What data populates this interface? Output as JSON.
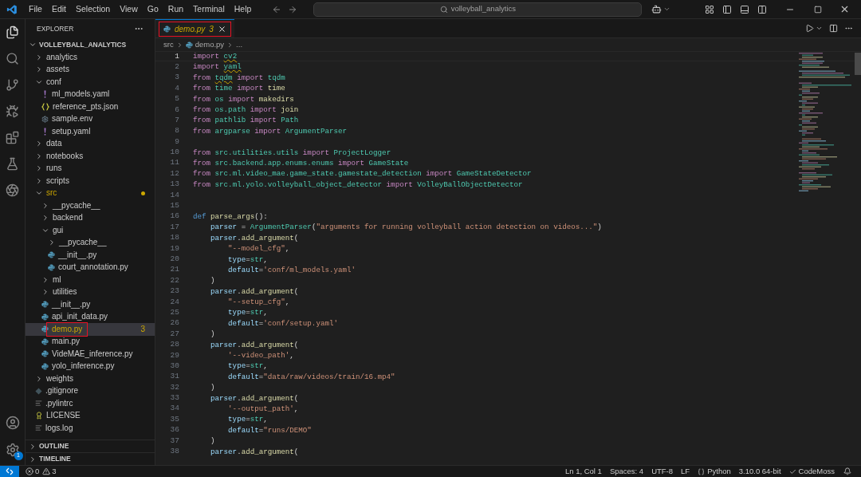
{
  "menu": [
    "File",
    "Edit",
    "Selection",
    "View",
    "Go",
    "Run",
    "Terminal",
    "Help"
  ],
  "command_center": {
    "text": "volleyball_analytics"
  },
  "settings_badge": "1",
  "explorer": {
    "title": "EXPLORER",
    "root": {
      "label": "VOLLEYBALL_ANALYTICS",
      "expanded": true
    },
    "items": [
      {
        "label": "analytics",
        "kind": "folder",
        "expanded": false,
        "selected": false,
        "warning": false,
        "annotated": false
      },
      {
        "label": "assets",
        "kind": "folder",
        "expanded": false,
        "selected": false,
        "warning": false,
        "annotated": false
      },
      {
        "label": "conf",
        "kind": "folder",
        "expanded": true,
        "selected": false,
        "warning": false,
        "annotated": false,
        "children": [
          {
            "label": "ml_models.yaml",
            "kind": "yaml",
            "selected": false,
            "warning": false,
            "annotated": false
          },
          {
            "label": "reference_pts.json",
            "kind": "json",
            "selected": false,
            "warning": false,
            "annotated": false
          },
          {
            "label": "sample.env",
            "kind": "env",
            "selected": false,
            "warning": false,
            "annotated": false
          },
          {
            "label": "setup.yaml",
            "kind": "yaml",
            "selected": false,
            "warning": false,
            "annotated": false
          }
        ]
      },
      {
        "label": "data",
        "kind": "folder",
        "expanded": false,
        "selected": false,
        "warning": false,
        "annotated": false
      },
      {
        "label": "notebooks",
        "kind": "folder",
        "expanded": false,
        "selected": false,
        "warning": false,
        "annotated": false
      },
      {
        "label": "runs",
        "kind": "folder",
        "expanded": false,
        "selected": false,
        "warning": false,
        "annotated": false
      },
      {
        "label": "scripts",
        "kind": "folder",
        "expanded": false,
        "selected": false,
        "warning": false,
        "annotated": false
      },
      {
        "label": "src",
        "kind": "folder",
        "expanded": true,
        "selected": false,
        "warning": true,
        "annotated": false,
        "children": [
          {
            "label": "__pycache__",
            "kind": "folder",
            "expanded": false,
            "selected": false,
            "warning": false,
            "annotated": false
          },
          {
            "label": "backend",
            "kind": "folder",
            "expanded": false,
            "selected": false,
            "warning": false,
            "annotated": false
          },
          {
            "label": "gui",
            "kind": "folder",
            "expanded": true,
            "selected": false,
            "warning": false,
            "annotated": false,
            "children": [
              {
                "label": "__pycache__",
                "kind": "folder",
                "expanded": false,
                "selected": false,
                "warning": false,
                "annotated": false
              },
              {
                "label": "__init__.py",
                "kind": "python",
                "selected": false,
                "warning": false,
                "annotated": false
              },
              {
                "label": "court_annotation.py",
                "kind": "python",
                "selected": false,
                "warning": false,
                "annotated": false
              }
            ]
          },
          {
            "label": "ml",
            "kind": "folder",
            "expanded": false,
            "selected": false,
            "warning": false,
            "annotated": false
          },
          {
            "label": "utilities",
            "kind": "folder",
            "expanded": false,
            "selected": false,
            "warning": false,
            "annotated": false
          },
          {
            "label": "__init__.py",
            "kind": "python",
            "selected": false,
            "warning": false,
            "annotated": false
          },
          {
            "label": "api_init_data.py",
            "kind": "python",
            "selected": false,
            "warning": false,
            "annotated": false
          },
          {
            "label": "demo.py",
            "kind": "python",
            "selected": true,
            "warning": true,
            "annotated": true,
            "badge": "3"
          },
          {
            "label": "main.py",
            "kind": "python",
            "selected": false,
            "warning": false,
            "annotated": false
          },
          {
            "label": "VideMAE_inference.py",
            "kind": "python",
            "selected": false,
            "warning": false,
            "annotated": false
          },
          {
            "label": "yolo_inference.py",
            "kind": "python",
            "selected": false,
            "warning": false,
            "annotated": false
          }
        ]
      },
      {
        "label": "weights",
        "kind": "folder",
        "expanded": false,
        "selected": false,
        "warning": false,
        "annotated": false
      },
      {
        "label": ".gitignore",
        "kind": "git",
        "selected": false,
        "warning": false,
        "annotated": false
      },
      {
        "label": ".pylintrc",
        "kind": "text",
        "selected": false,
        "warning": false,
        "annotated": false
      },
      {
        "label": "LICENSE",
        "kind": "license",
        "selected": false,
        "warning": false,
        "annotated": false
      },
      {
        "label": "logs.log",
        "kind": "text",
        "selected": false,
        "warning": false,
        "annotated": false
      }
    ]
  },
  "sections": [
    {
      "label": "OUTLINE",
      "expanded": false
    },
    {
      "label": "TIMELINE",
      "expanded": false
    }
  ],
  "tabs": [
    {
      "label": "demo.py",
      "badge": "3",
      "selected": true,
      "annotated": true
    }
  ],
  "breadcrumb": [
    "src",
    "demo.py",
    "..."
  ],
  "editor": {
    "lines": [
      {
        "n": "1",
        "current": true,
        "t": [
          {
            "kind": "kw",
            "text": "import "
          },
          {
            "kind": "modw",
            "text": "cv2"
          }
        ]
      },
      {
        "n": "2",
        "current": false,
        "t": [
          {
            "kind": "kw",
            "text": "import "
          },
          {
            "kind": "modw",
            "text": "yaml"
          }
        ]
      },
      {
        "n": "3",
        "current": false,
        "t": [
          {
            "kind": "kw",
            "text": "from "
          },
          {
            "kind": "modw",
            "text": "tqdm"
          },
          {
            "kind": "kw",
            "text": " import "
          },
          {
            "kind": "mod",
            "text": "tqdm"
          }
        ]
      },
      {
        "n": "4",
        "current": false,
        "t": [
          {
            "kind": "kw",
            "text": "from "
          },
          {
            "kind": "mod",
            "text": "time "
          },
          {
            "kind": "kw",
            "text": "import "
          },
          {
            "kind": "fn",
            "text": "time"
          }
        ]
      },
      {
        "n": "5",
        "current": false,
        "t": [
          {
            "kind": "kw",
            "text": "from "
          },
          {
            "kind": "mod",
            "text": "os "
          },
          {
            "kind": "kw",
            "text": "import "
          },
          {
            "kind": "fn",
            "text": "makedirs"
          }
        ]
      },
      {
        "n": "6",
        "current": false,
        "t": [
          {
            "kind": "kw",
            "text": "from "
          },
          {
            "kind": "mod",
            "text": "os.path "
          },
          {
            "kind": "kw",
            "text": "import "
          },
          {
            "kind": "fn",
            "text": "join"
          }
        ]
      },
      {
        "n": "7",
        "current": false,
        "t": [
          {
            "kind": "kw",
            "text": "from "
          },
          {
            "kind": "mod",
            "text": "pathlib "
          },
          {
            "kind": "kw",
            "text": "import "
          },
          {
            "kind": "mod",
            "text": "Path"
          }
        ]
      },
      {
        "n": "8",
        "current": false,
        "t": [
          {
            "kind": "kw",
            "text": "from "
          },
          {
            "kind": "mod",
            "text": "argparse "
          },
          {
            "kind": "kw",
            "text": "import "
          },
          {
            "kind": "mod",
            "text": "ArgumentParser"
          }
        ]
      },
      {
        "n": "9",
        "current": false
      },
      {
        "n": "10",
        "current": false,
        "t": [
          {
            "kind": "kw",
            "text": "from "
          },
          {
            "kind": "mod",
            "text": "src.utilities.utils "
          },
          {
            "kind": "kw",
            "text": "import "
          },
          {
            "kind": "mod",
            "text": "ProjectLogger"
          }
        ]
      },
      {
        "n": "11",
        "current": false,
        "t": [
          {
            "kind": "kw",
            "text": "from "
          },
          {
            "kind": "mod",
            "text": "src.backend.app.enums.enums "
          },
          {
            "kind": "kw",
            "text": "import "
          },
          {
            "kind": "mod",
            "text": "GameState"
          }
        ]
      },
      {
        "n": "12",
        "current": false,
        "t": [
          {
            "kind": "kw",
            "text": "from "
          },
          {
            "kind": "mod",
            "text": "src.ml.video_mae.game_state.gamestate_detection "
          },
          {
            "kind": "kw",
            "text": "import "
          },
          {
            "kind": "mod",
            "text": "GameStateDetector"
          }
        ]
      },
      {
        "n": "13",
        "current": false,
        "t": [
          {
            "kind": "kw",
            "text": "from "
          },
          {
            "kind": "mod",
            "text": "src.ml.yolo.volleyball_object_detector "
          },
          {
            "kind": "kw",
            "text": "import "
          },
          {
            "kind": "mod",
            "text": "VolleyBallObjectDetector"
          }
        ]
      },
      {
        "n": "14",
        "current": false
      },
      {
        "n": "15",
        "current": false
      },
      {
        "n": "16",
        "current": false,
        "t": [
          {
            "kind": "def",
            "text": "def "
          },
          {
            "kind": "fn",
            "text": "parse_args"
          },
          {
            "kind": "p",
            "text": "():"
          }
        ]
      },
      {
        "n": "17",
        "current": false,
        "t": [
          {
            "kind": "var",
            "text": "    parser"
          },
          {
            "kind": "p",
            "text": " = "
          },
          {
            "kind": "mod",
            "text": "ArgumentParser"
          },
          {
            "kind": "p",
            "text": "("
          },
          {
            "kind": "str",
            "text": "\"arguments for running volleyball action detection on videos...\""
          },
          {
            "kind": "p",
            "text": ")"
          }
        ]
      },
      {
        "n": "18",
        "current": false,
        "t": [
          {
            "kind": "var",
            "text": "    parser"
          },
          {
            "kind": "p",
            "text": "."
          },
          {
            "kind": "fn",
            "text": "add_argument"
          },
          {
            "kind": "p",
            "text": "("
          }
        ]
      },
      {
        "n": "19",
        "current": false,
        "t": [
          {
            "kind": "str",
            "text": "        \"--model_cfg\""
          },
          {
            "kind": "p",
            "text": ","
          }
        ]
      },
      {
        "n": "20",
        "current": false,
        "t": [
          {
            "kind": "var",
            "text": "        type"
          },
          {
            "kind": "p",
            "text": "="
          },
          {
            "kind": "mod",
            "text": "str"
          },
          {
            "kind": "p",
            "text": ","
          }
        ]
      },
      {
        "n": "21",
        "current": false,
        "t": [
          {
            "kind": "var",
            "text": "        default"
          },
          {
            "kind": "p",
            "text": "="
          },
          {
            "kind": "str",
            "text": "'conf/ml_models.yaml'"
          }
        ]
      },
      {
        "n": "22",
        "current": false,
        "t": [
          {
            "kind": "p",
            "text": "    )"
          }
        ]
      },
      {
        "n": "23",
        "current": false,
        "t": [
          {
            "kind": "var",
            "text": "    parser"
          },
          {
            "kind": "p",
            "text": "."
          },
          {
            "kind": "fn",
            "text": "add_argument"
          },
          {
            "kind": "p",
            "text": "("
          }
        ]
      },
      {
        "n": "24",
        "current": false,
        "t": [
          {
            "kind": "str",
            "text": "        \"--setup_cfg\""
          },
          {
            "kind": "p",
            "text": ","
          }
        ]
      },
      {
        "n": "25",
        "current": false,
        "t": [
          {
            "kind": "var",
            "text": "        type"
          },
          {
            "kind": "p",
            "text": "="
          },
          {
            "kind": "mod",
            "text": "str"
          },
          {
            "kind": "p",
            "text": ","
          }
        ]
      },
      {
        "n": "26",
        "current": false,
        "t": [
          {
            "kind": "var",
            "text": "        default"
          },
          {
            "kind": "p",
            "text": "="
          },
          {
            "kind": "str",
            "text": "'conf/setup.yaml'"
          }
        ]
      },
      {
        "n": "27",
        "current": false,
        "t": [
          {
            "kind": "p",
            "text": "    )"
          }
        ]
      },
      {
        "n": "28",
        "current": false,
        "t": [
          {
            "kind": "var",
            "text": "    parser"
          },
          {
            "kind": "p",
            "text": "."
          },
          {
            "kind": "fn",
            "text": "add_argument"
          },
          {
            "kind": "p",
            "text": "("
          }
        ]
      },
      {
        "n": "29",
        "current": false,
        "t": [
          {
            "kind": "str",
            "text": "        '--video_path'"
          },
          {
            "kind": "p",
            "text": ","
          }
        ]
      },
      {
        "n": "30",
        "current": false,
        "t": [
          {
            "kind": "var",
            "text": "        type"
          },
          {
            "kind": "p",
            "text": "="
          },
          {
            "kind": "mod",
            "text": "str"
          },
          {
            "kind": "p",
            "text": ","
          }
        ]
      },
      {
        "n": "31",
        "current": false,
        "t": [
          {
            "kind": "var",
            "text": "        default"
          },
          {
            "kind": "p",
            "text": "="
          },
          {
            "kind": "str",
            "text": "\"data/raw/videos/train/16.mp4\""
          }
        ]
      },
      {
        "n": "32",
        "current": false,
        "t": [
          {
            "kind": "p",
            "text": "    )"
          }
        ]
      },
      {
        "n": "33",
        "current": false,
        "t": [
          {
            "kind": "var",
            "text": "    parser"
          },
          {
            "kind": "p",
            "text": "."
          },
          {
            "kind": "fn",
            "text": "add_argument"
          },
          {
            "kind": "p",
            "text": "("
          }
        ]
      },
      {
        "n": "34",
        "current": false,
        "t": [
          {
            "kind": "str",
            "text": "        '--output_path'"
          },
          {
            "kind": "p",
            "text": ","
          }
        ]
      },
      {
        "n": "35",
        "current": false,
        "t": [
          {
            "kind": "var",
            "text": "        type"
          },
          {
            "kind": "p",
            "text": "="
          },
          {
            "kind": "mod",
            "text": "str"
          },
          {
            "kind": "p",
            "text": ","
          }
        ]
      },
      {
        "n": "36",
        "current": false,
        "t": [
          {
            "kind": "var",
            "text": "        default"
          },
          {
            "kind": "p",
            "text": "="
          },
          {
            "kind": "str",
            "text": "\"runs/DEMO\""
          }
        ]
      },
      {
        "n": "37",
        "current": false,
        "t": [
          {
            "kind": "p",
            "text": "    )"
          }
        ]
      },
      {
        "n": "38",
        "current": false,
        "t": [
          {
            "kind": "var",
            "text": "    parser"
          },
          {
            "kind": "p",
            "text": "."
          },
          {
            "kind": "fn",
            "text": "add_argument"
          },
          {
            "kind": "p",
            "text": "("
          }
        ]
      }
    ]
  },
  "status_bar": {
    "errors": "0",
    "warnings": "3",
    "items": [
      {
        "kind": "text",
        "text": "Ln 1, Col 1"
      },
      {
        "kind": "text",
        "text": "Spaces: 4"
      },
      {
        "kind": "text",
        "text": "UTF-8"
      },
      {
        "kind": "text",
        "text": "LF"
      },
      {
        "kind": "language",
        "text": "Python"
      },
      {
        "kind": "text",
        "text": "3.10.0 64-bit"
      },
      {
        "kind": "extension",
        "text": "CodeMoss"
      }
    ]
  }
}
